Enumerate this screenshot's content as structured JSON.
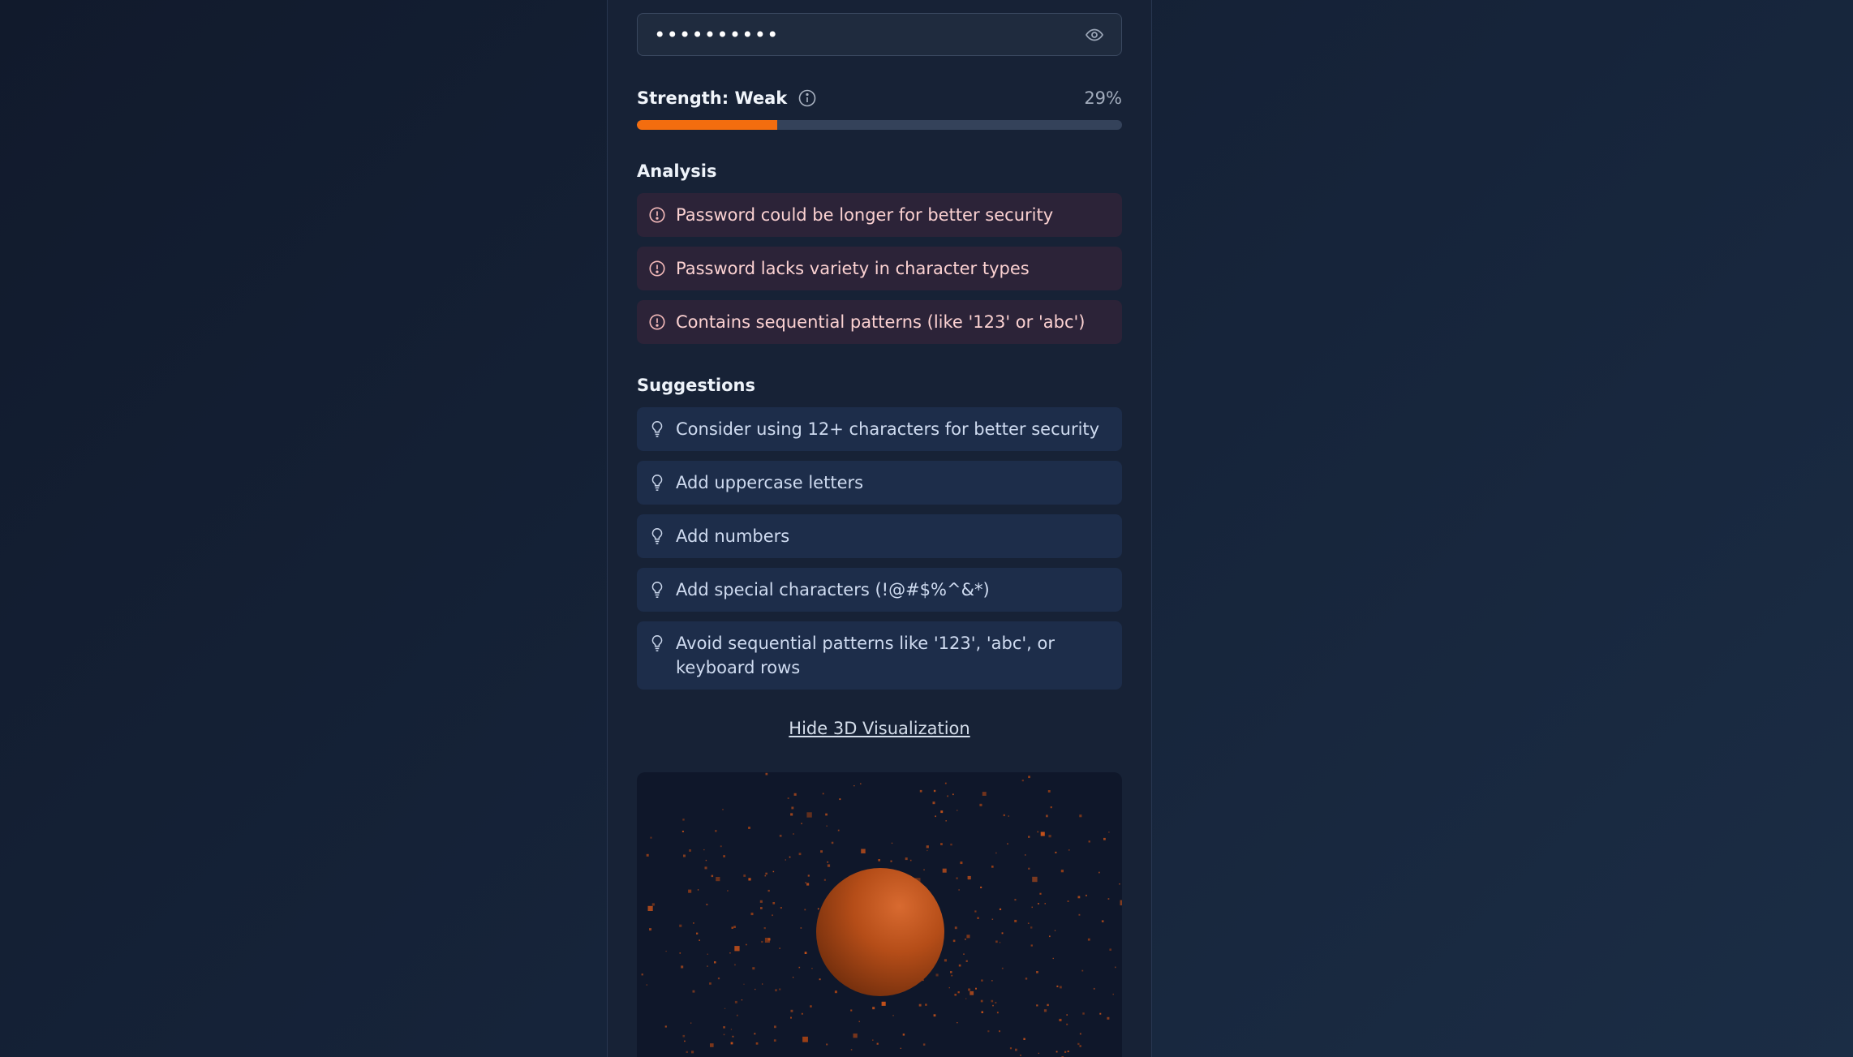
{
  "password": {
    "masked_value": "••••••••••",
    "toggle_icon": "eye-icon"
  },
  "strength": {
    "label": "Strength: Weak",
    "percent_text": "29%",
    "percent": 29,
    "bar_color": "#f36d0f",
    "info_icon": "info-icon"
  },
  "analysis": {
    "title": "Analysis",
    "items": [
      "Password could be longer for better security",
      "Password lacks variety in character types",
      "Contains sequential patterns (like '123' or 'abc')"
    ]
  },
  "suggestions": {
    "title": "Suggestions",
    "items": [
      "Consider using 12+ characters for better security",
      "Add uppercase letters",
      "Add numbers",
      "Add special characters (!@#$%^&*)",
      "Avoid sequential patterns like '123', 'abc', or keyboard rows"
    ]
  },
  "visualization": {
    "toggle_label": "Hide 3D Visualization",
    "sphere_color": "#c2501a"
  }
}
